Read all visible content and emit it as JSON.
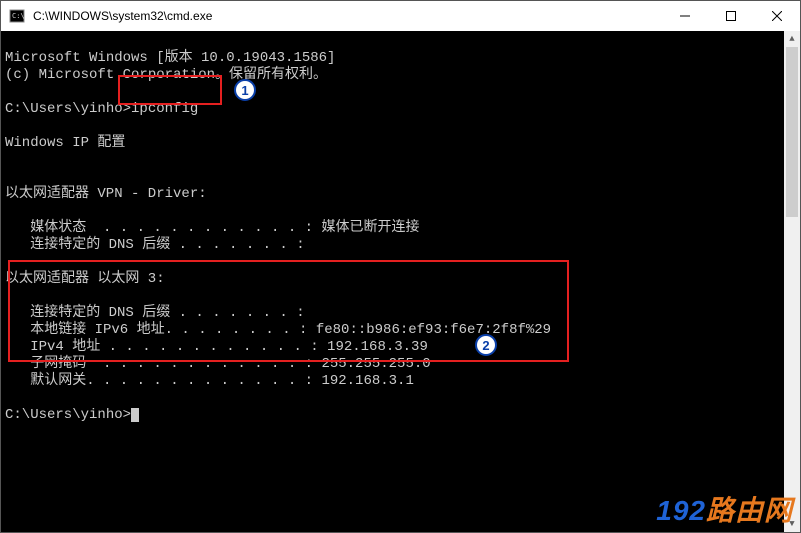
{
  "window": {
    "title": "C:\\WINDOWS\\system32\\cmd.exe"
  },
  "terminal": {
    "header1": "Microsoft Windows [版本 10.0.19043.1586]",
    "header2": "(c) Microsoft Corporation。保留所有权利。",
    "prompt1_prefix": "C:\\Users\\yinho>",
    "prompt1_cmd": "ipconfig",
    "section_title": "Windows IP 配置",
    "adapter1_title": "以太网适配器 VPN - Driver:",
    "adapter1_line1": "   媒体状态  . . . . . . . . . . . . : 媒体已断开连接",
    "adapter1_line2": "   连接特定的 DNS 后缀 . . . . . . . :",
    "adapter2_title": "以太网适配器 以太网 3:",
    "adapter2_line1": "   连接特定的 DNS 后缀 . . . . . . . :",
    "adapter2_line2": "   本地链接 IPv6 地址. . . . . . . . : fe80::b986:ef93:f6e7:2f8f%29",
    "adapter2_line3": "   IPv4 地址 . . . . . . . . . . . . : 192.168.3.39",
    "adapter2_line4": "   子网掩码  . . . . . . . . . . . . : 255.255.255.0",
    "adapter2_line5": "   默认网关. . . . . . . . . . . . . : 192.168.3.1",
    "prompt2": "C:\\Users\\yinho>"
  },
  "callouts": {
    "one": "1",
    "two": "2"
  },
  "watermark": {
    "num": "192",
    "chn": "路由网"
  }
}
